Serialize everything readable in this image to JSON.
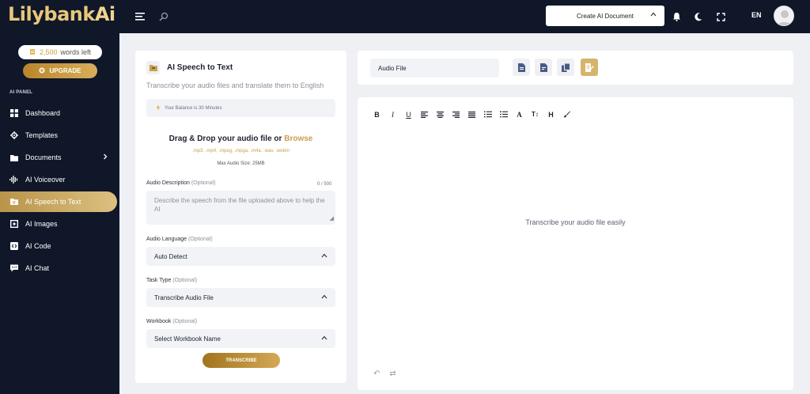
{
  "app": {
    "logo_main": "Lilybank",
    "logo_ai": "Ai"
  },
  "topbar": {
    "create_doc_label": "Create AI Document",
    "lang": "EN"
  },
  "sidebar": {
    "words_count": "2,500",
    "words_suffix": "words left",
    "upgrade_label": "UPGRADE",
    "panel_label": "AI PANEL",
    "items": [
      {
        "label": "Dashboard"
      },
      {
        "label": "Templates"
      },
      {
        "label": "Documents"
      },
      {
        "label": "AI Voiceover"
      },
      {
        "label": "AI Speech to Text"
      },
      {
        "label": "AI Images"
      },
      {
        "label": "AI Code"
      },
      {
        "label": "AI Chat"
      }
    ]
  },
  "left_card": {
    "title": "AI Speech to Text",
    "subtitle": "Transcribe your audio files and translate them to English",
    "balance": "Your Balance is 30 Minutes",
    "drag_text": "Drag & Drop your audio file or",
    "browse": "Browse",
    "formats": ".mp3, .mp4, .mpeg, .mpga, .m4a, .wav, .webm",
    "max_size": "Max Audio Size: 25MB",
    "desc_label": "Audio Description",
    "desc_optional": "(Optional)",
    "desc_counter": "0 / 500",
    "desc_placeholder": "Describe the speech from the file uploaded above to help the AI",
    "lang_label": "Audio Language",
    "lang_optional": "(Optional)",
    "lang_value": "Auto Detect",
    "task_label": "Task Type",
    "task_optional": "(Optional)",
    "task_value": "Transcribe Audio File",
    "workbook_label": "Workbook",
    "workbook_optional": "(Optional)",
    "workbook_value": "Select Workbook Name",
    "transcribe_label": "TRANSCRIBE"
  },
  "right_top": {
    "audio_file_value": "Audio File"
  },
  "editor": {
    "placeholder": "Transcribe your audio file easily"
  }
}
